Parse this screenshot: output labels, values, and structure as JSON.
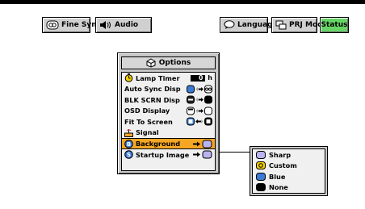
{
  "toolbar": {
    "fine_sync": "Fine Sync",
    "audio": "Audio",
    "language": "Language",
    "prj_mode": "PRJ Mode",
    "status": "Status"
  },
  "menu": {
    "title": "Options",
    "items": [
      {
        "label": "Lamp Timer",
        "value": "0",
        "unit": "h"
      },
      {
        "label": "Auto Sync Disp"
      },
      {
        "label": "BLK SCRN Disp"
      },
      {
        "label": "OSD Display"
      },
      {
        "label": "Fit To Screen"
      },
      {
        "label": "Signal"
      },
      {
        "label": "Background",
        "selected": true
      },
      {
        "label": "Startup Image"
      }
    ]
  },
  "submenu": {
    "options": [
      "Sharp",
      "Custom",
      "Blue",
      "None"
    ]
  },
  "colors": {
    "status_green": "#67d565",
    "selected_row": "#f5a623",
    "panel_gray": "#c8c8c8",
    "blue_icon": "#3a7bd5"
  }
}
